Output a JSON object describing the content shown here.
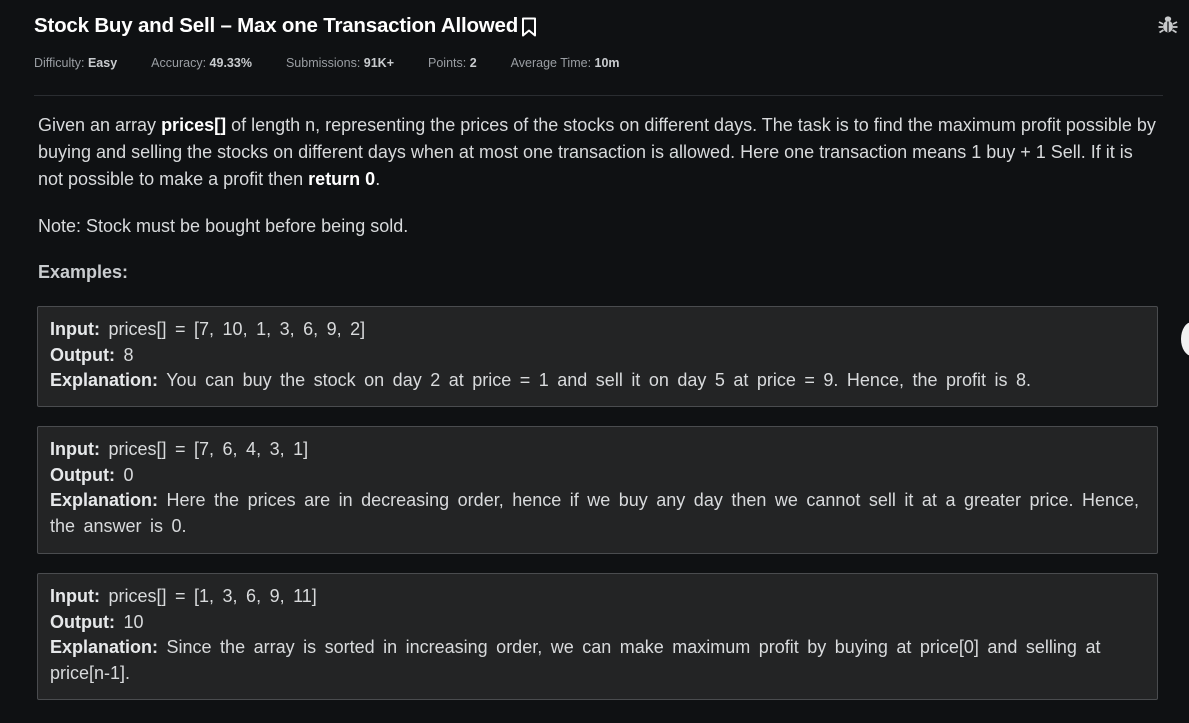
{
  "problem": {
    "title": "Stock Buy and Sell – Max one Transaction Allowed",
    "meta": [
      {
        "label": "Difficulty:",
        "value": "Easy"
      },
      {
        "label": "Accuracy:",
        "value": "49.33%"
      },
      {
        "label": "Submissions:",
        "value": "91K+"
      },
      {
        "label": "Points:",
        "value": "2"
      },
      {
        "label": "Average Time:",
        "value": "10m"
      }
    ]
  },
  "description": {
    "p1_a": "Given an array ",
    "p1_b": "prices[]",
    "p1_c": " of length n, representing the prices of the stocks on different days. The task is to find the maximum profit possible by buying and selling the stocks on different days when at most one transaction is allowed. Here one transaction means 1 buy + 1 Sell. If it is not possible to make a profit then ",
    "p1_d": "return 0",
    "p1_e": ".",
    "note": "Note: Stock must be bought before being sold.",
    "examples_heading": "Examples:"
  },
  "examples": [
    {
      "input_label": "Input:",
      "input": "prices[] = [7, 10, 1, 3, 6, 9, 2]",
      "output_label": "Output:",
      "output": "8",
      "explanation_label": "Explanation:",
      "explanation": "You can buy the stock on day 2 at price = 1 and sell it on day 5 at price = 9. Hence, the profit is 8."
    },
    {
      "input_label": "Input:",
      "input": "prices[] = [7, 6, 4, 3, 1]",
      "output_label": "Output:",
      "output": "0",
      "explanation_label": "Explanation:",
      "explanation": "Here the prices are in decreasing order, hence if we buy any day then we cannot sell it at a greater price. Hence, the answer is 0."
    },
    {
      "input_label": "Input:",
      "input": "prices[] = [1, 3, 6, 9, 11]",
      "output_label": "Output:",
      "output": "10",
      "explanation_label": "Explanation:",
      "explanation": "Since the array is sorted in increasing order, we can make maximum profit by buying at price[0] and selling at price[n-1]."
    }
  ],
  "icons": {
    "bookmark": "bookmark-icon",
    "bug": "bug-icon"
  },
  "colors": {
    "background": "#0f1113",
    "box_background": "#232425",
    "box_border": "#4a4c4f"
  }
}
